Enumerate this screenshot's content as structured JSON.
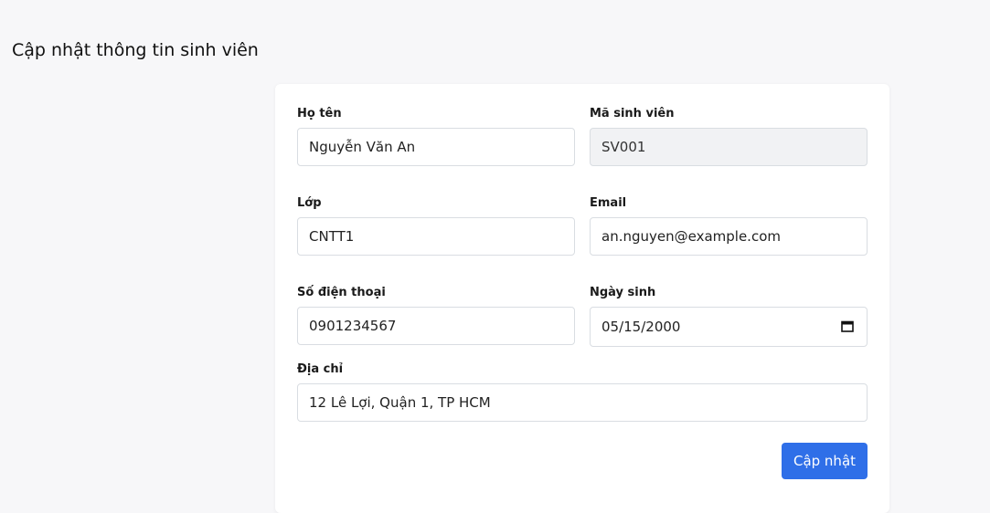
{
  "page": {
    "title": "Cập nhật thông tin sinh viên"
  },
  "form": {
    "full_name": {
      "label": "Họ tên",
      "value": "Nguyễn Văn An"
    },
    "student_id": {
      "label": "Mã sinh viên",
      "value": "SV001"
    },
    "class": {
      "label": "Lớp",
      "value": "CNTT1"
    },
    "email": {
      "label": "Email",
      "value": "an.nguyen@example.com"
    },
    "phone": {
      "label": "Số điện thoại",
      "value": "0901234567"
    },
    "birthday": {
      "label": "Ngày sinh",
      "value": "05/15/2000"
    },
    "address": {
      "label": "Địa chỉ",
      "value": "12 Lê Lợi, Quận 1, TP HCM"
    },
    "submit_label": "Cập nhật"
  },
  "icons": {
    "birthday_picker": "calendar-icon"
  },
  "colors": {
    "primary": "#2f6fe8",
    "background": "#f7f7f9",
    "card": "#ffffff",
    "readonly_field": "#f1f2f4"
  }
}
